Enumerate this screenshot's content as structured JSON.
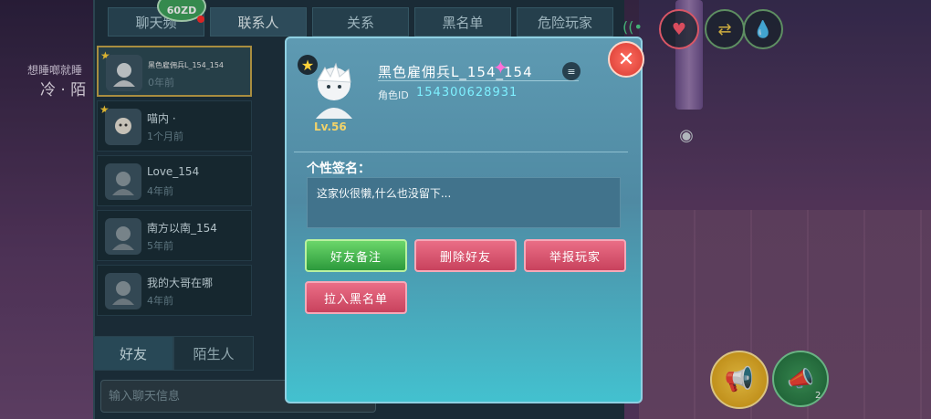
{
  "top_tabs": [
    "聊天频",
    "联系人",
    "关系",
    "黑名单",
    "危险玩家"
  ],
  "fps_badge": "60ZD",
  "left_overlay": {
    "line1": "想睡啷就睡",
    "line2": "冷 · 陌"
  },
  "contacts": [
    {
      "name": "黑色雇佣兵L_154_154",
      "time": "0年前",
      "selected": true
    },
    {
      "name": "喵内 ·",
      "time": "1个月前",
      "selected": false
    },
    {
      "name": "Love_154",
      "time": "4年前",
      "selected": false
    },
    {
      "name": "南方以南_154",
      "time": "5年前",
      "selected": false
    },
    {
      "name": "我的大哥在哪",
      "time": "4年前",
      "selected": false
    }
  ],
  "bottom_tabs": {
    "friends": "好友",
    "strangers": "陌生人"
  },
  "chat_input": {
    "placeholder": "输入聊天信息"
  },
  "modal": {
    "name": "黑色雇佣兵L_154_154",
    "level": "Lv.56",
    "id_label": "角色ID",
    "id_value": "154300628931",
    "signature_label": "个性签名：",
    "signature_text": "这家伙很懒,什么也没留下...",
    "buttons": {
      "remark": "好友备注",
      "delete": "删除好友",
      "report": "举报玩家",
      "blacklist": "拉入黑名单"
    }
  },
  "hud": {
    "horn_count": "2"
  },
  "colors": {
    "accent_green": "#2c9a3c",
    "accent_red": "#c8425d",
    "id_cyan": "#7ef0ff",
    "panel_teal": "#4f8aa3"
  }
}
